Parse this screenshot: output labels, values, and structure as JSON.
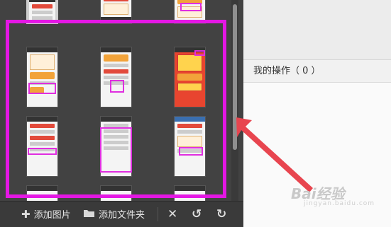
{
  "toolbar": {
    "add_image_label": "添加图片",
    "add_folder_label": "添加文件夹"
  },
  "right_panel": {
    "operations_label": "我的操作（ 0 ）"
  },
  "watermark": {
    "brand": "Bai经验",
    "url": "jingyan.baidu.com"
  },
  "colors": {
    "highlight": "#e417e4",
    "arrow": "#e8454f"
  }
}
